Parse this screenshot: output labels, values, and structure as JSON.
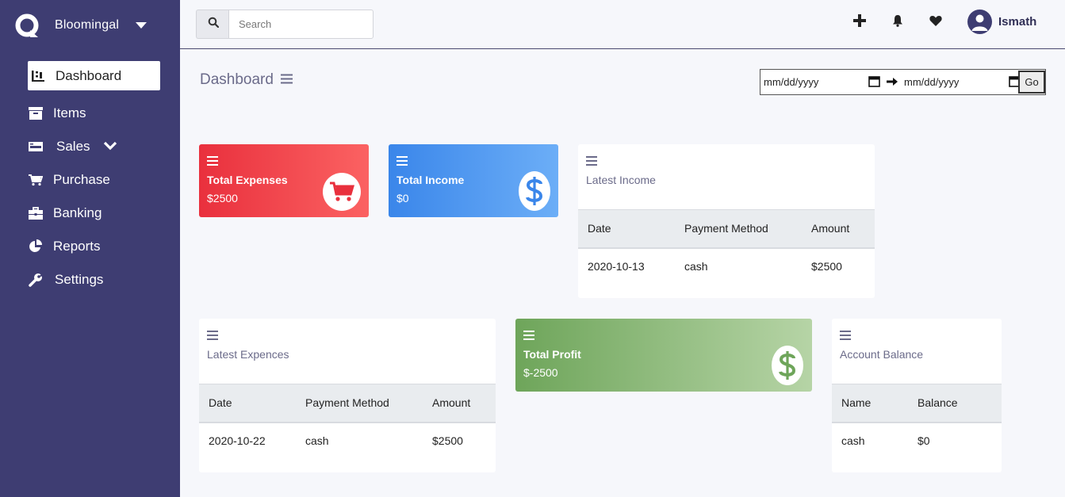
{
  "brand": {
    "name": "Bloomingal"
  },
  "sidebar": {
    "items": [
      {
        "label": "Dashboard",
        "icon": "dashboard-icon",
        "active": true
      },
      {
        "label": "Items",
        "icon": "archive-icon"
      },
      {
        "label": "Sales",
        "icon": "money-bill-icon"
      },
      {
        "label": "Purchase",
        "icon": "cart-icon"
      },
      {
        "label": "Banking",
        "icon": "briefcase-icon"
      },
      {
        "label": "Reports",
        "icon": "chart-pie-icon"
      },
      {
        "label": "Settings",
        "icon": "wrench-icon"
      }
    ]
  },
  "search": {
    "placeholder": "Search"
  },
  "user": {
    "name": "Ismath"
  },
  "page": {
    "title": "Dashboard"
  },
  "date_range": {
    "from_placeholder": "mm/dd/yyyy",
    "to_placeholder": "mm/dd/yyyy",
    "go_label": "Go"
  },
  "cards": {
    "expenses": {
      "label": "Total Expenses",
      "value": "$2500",
      "color": "#e9303d"
    },
    "income": {
      "label": "Total Income",
      "value": "$0",
      "color": "#3a86ea"
    },
    "profit": {
      "label": "Total Profit",
      "value": "$-2500",
      "color": "#6ea55a"
    }
  },
  "latest_income": {
    "title": "Latest Income",
    "headers": [
      "Date",
      "Payment Method",
      "Amount"
    ],
    "rows": [
      [
        "2020-10-13",
        "cash",
        "$2500"
      ]
    ]
  },
  "latest_expences": {
    "title": "Latest Expences",
    "headers": [
      "Date",
      "Payment Method",
      "Amount"
    ],
    "rows": [
      [
        "2020-10-22",
        "cash",
        "$2500"
      ]
    ]
  },
  "account_balance": {
    "title": "Account Balance",
    "headers": [
      "Name",
      "Balance"
    ],
    "rows": [
      [
        "cash",
        "$0"
      ]
    ]
  },
  "colors": {
    "sidebar": "#3e3d72",
    "background": "#f6f7fb"
  }
}
